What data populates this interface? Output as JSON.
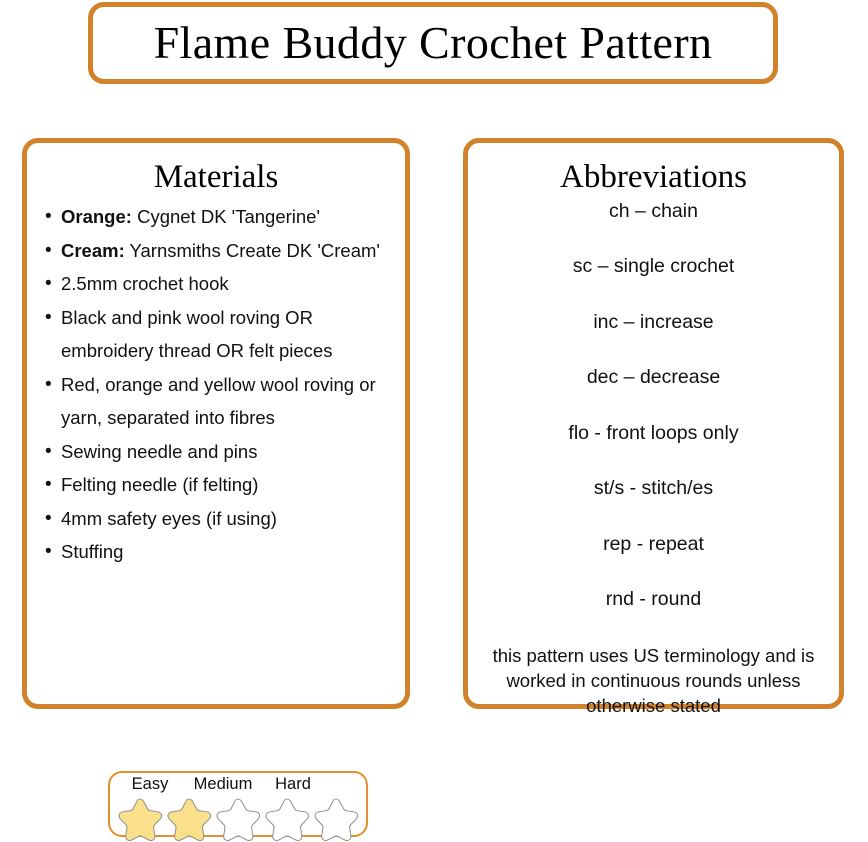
{
  "title": {
    "text": "Flame Buddy Crochet Pattern"
  },
  "colors": {
    "border_orange": "#D2822A",
    "difficulty_border": "#E39030",
    "star_filled": "#FBE08C",
    "star_outline": "#8A8A8A",
    "text": "#111111",
    "background": "#FFFFFF"
  },
  "materials": {
    "heading": "Materials",
    "items": [
      {
        "label": "Orange:",
        "text": " Cygnet DK 'Tangerine'"
      },
      {
        "label": "Cream:",
        "text": " Yarnsmiths Create DK 'Cream'"
      },
      {
        "label": "",
        "text": "2.5mm crochet hook"
      },
      {
        "label": "",
        "text": "Black and pink wool roving OR embroidery thread OR felt pieces"
      },
      {
        "label": "",
        "text": "Red, orange and yellow wool roving or yarn, separated into fibres"
      },
      {
        "label": "",
        "text": "Sewing needle and pins"
      },
      {
        "label": "",
        "text": "Felting needle (if felting)"
      },
      {
        "label": "",
        "text": "4mm safety eyes (if using)"
      },
      {
        "label": "",
        "text": "Stuffing"
      }
    ],
    "difficulty": {
      "labels": [
        "Easy",
        "Medium",
        "Hard"
      ],
      "total_stars": 5,
      "filled_stars": 2
    }
  },
  "abbreviations": {
    "heading": "Abbreviations",
    "entries": [
      "ch – chain",
      "sc – single crochet",
      "inc – increase",
      "dec – decrease",
      "flo - front loops only",
      "st/s - stitch/es",
      "rep - repeat",
      "rnd - round"
    ],
    "note": "this pattern uses US terminology and is worked in continuous rounds unless otherwise stated"
  }
}
